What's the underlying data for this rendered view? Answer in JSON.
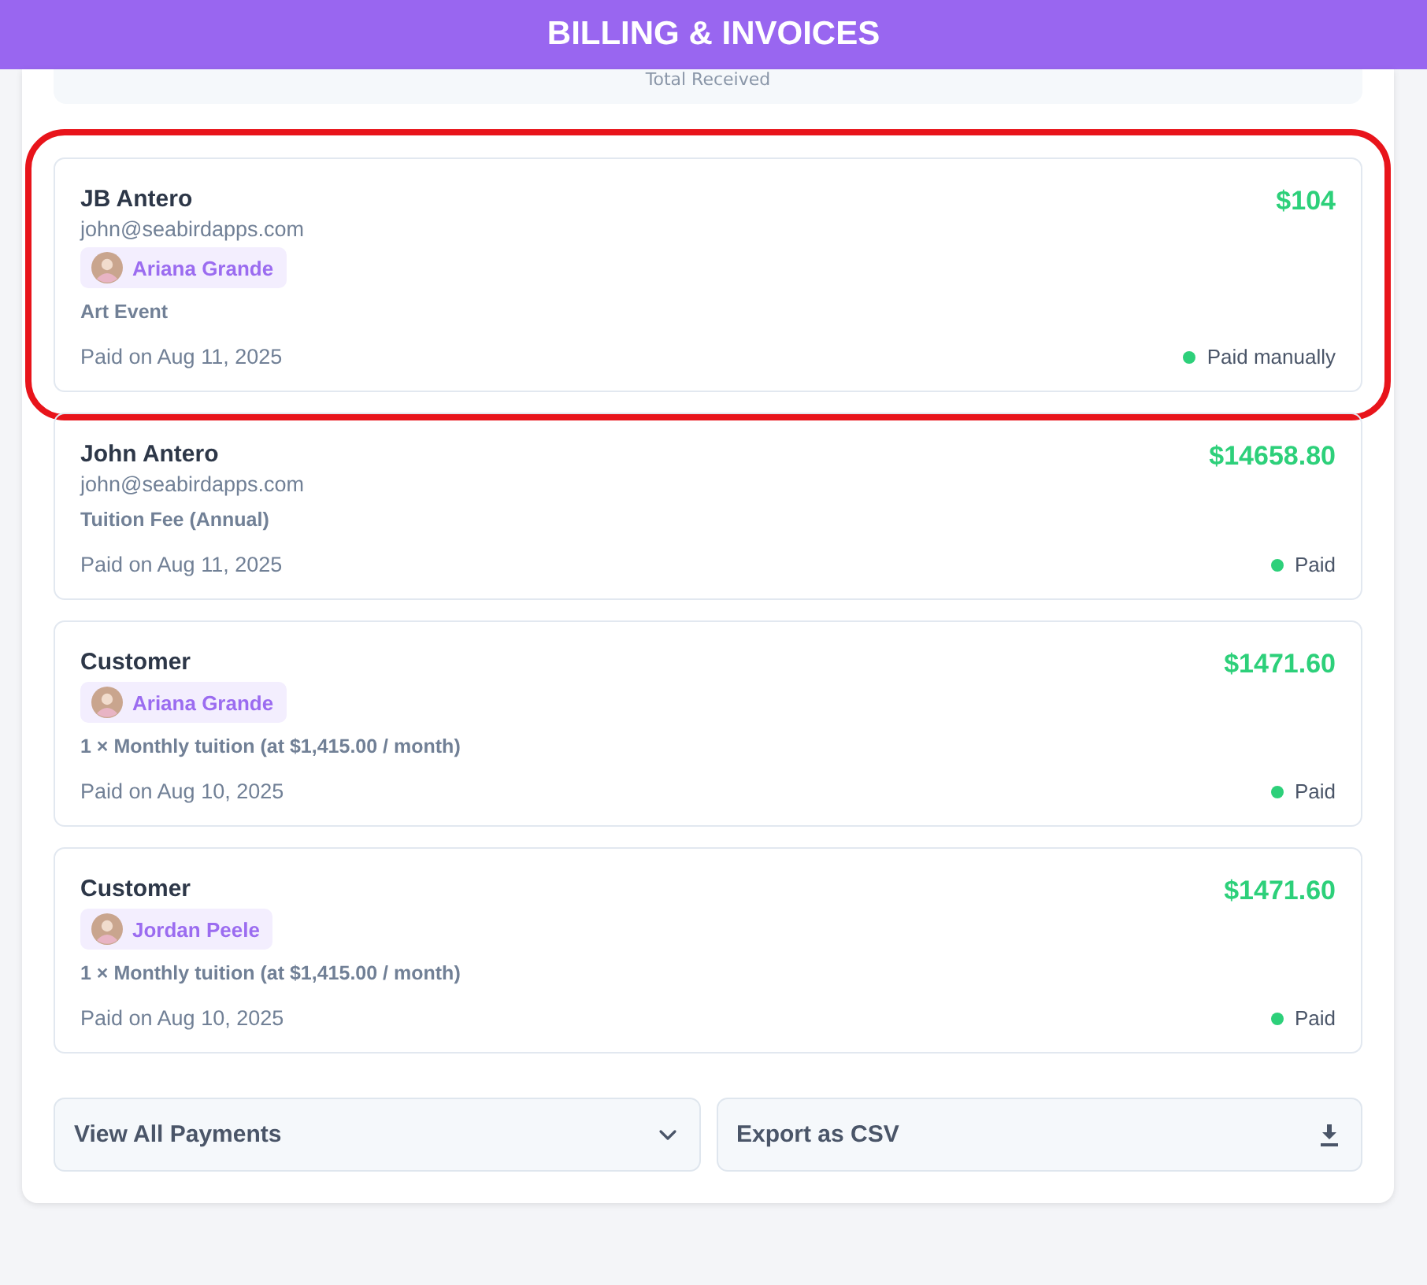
{
  "header": {
    "title": "BILLING & INVOICES"
  },
  "summary": {
    "label": "Total Received"
  },
  "payments": [
    {
      "name": "JB Antero",
      "email": "john@seabirdapps.com",
      "student": "Ariana Grande",
      "description": "Art Event",
      "date": "Paid on Aug 11, 2025",
      "amount": "$104",
      "status": "Paid manually",
      "color": "#2dd07a",
      "highlighted": true
    },
    {
      "name": "John Antero",
      "email": "john@seabirdapps.com",
      "description": "Tuition Fee (Annual)",
      "date": "Paid on Aug 11, 2025",
      "amount": "$14658.80",
      "status": "Paid",
      "color": "#2dd07a",
      "highlighted": false
    },
    {
      "name": "Customer",
      "student": "Ariana Grande",
      "description": "1 × Monthly tuition (at $1,415.00 / month)",
      "date": "Paid on Aug 10, 2025",
      "amount": "$1471.60",
      "status": "Paid",
      "color": "#2dd07a",
      "highlighted": false
    },
    {
      "name": "Customer",
      "student": "Jordan Peele",
      "description": "1 × Monthly tuition (at $1,415.00 / month)",
      "date": "Paid on Aug 10, 2025",
      "amount": "$1471.60",
      "status": "Paid",
      "color": "#2dd07a",
      "highlighted": false
    }
  ],
  "actions": [
    {
      "label": "View All Payments",
      "kind": "dropdown"
    },
    {
      "label": "Export as CSV",
      "kind": "download"
    }
  ]
}
